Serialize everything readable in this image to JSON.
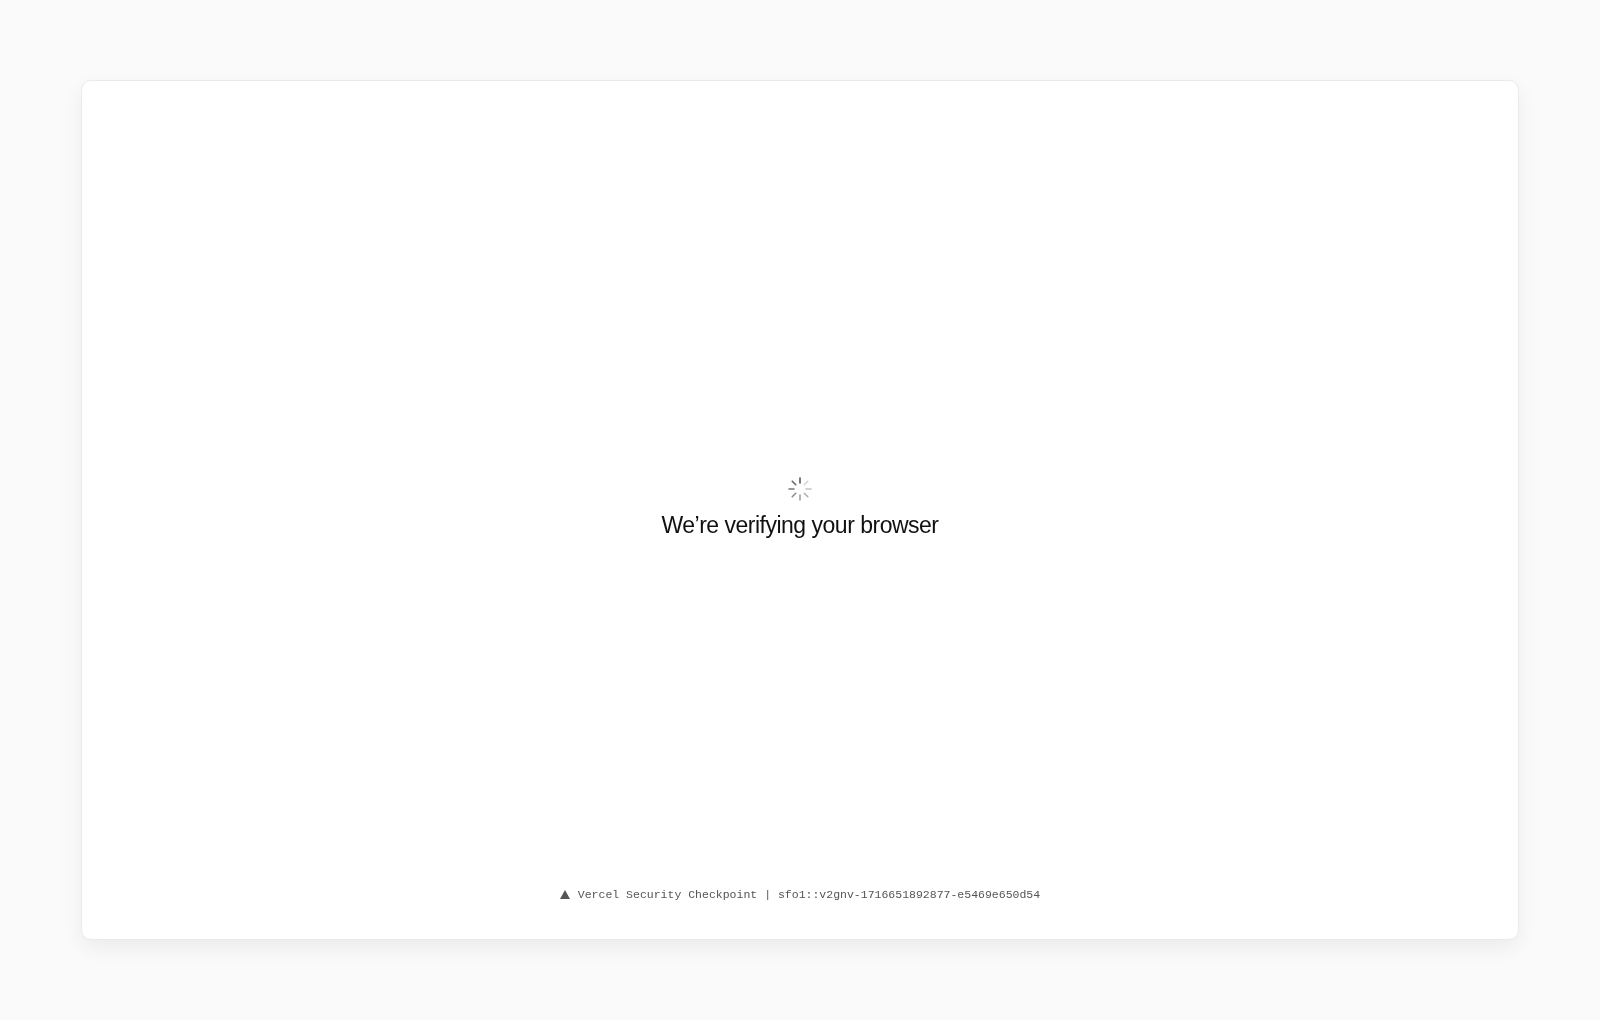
{
  "card": {
    "heading": "We’re verifying your browser",
    "footer": "Vercel Security Checkpoint | sfo1::v2gnv-1716651892877-e5469e650d54"
  }
}
